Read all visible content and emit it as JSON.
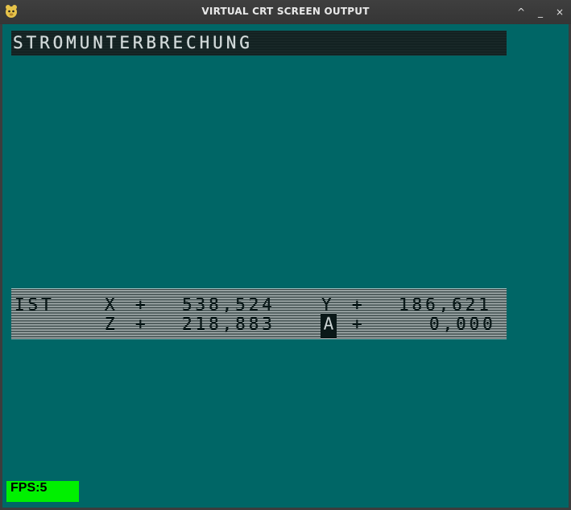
{
  "window": {
    "title": "VIRTUAL CRT SCREEN OUTPUT",
    "buttons": {
      "roll_up": "^",
      "minimize": "_",
      "close": "×"
    }
  },
  "screen": {
    "background": "#006666",
    "message": "STROMUNTERBRECHUNG",
    "position_display": {
      "label": "IST",
      "line1": {
        "axis1": "X",
        "sign1": "+",
        "value1": "538,524",
        "axis2": "Y",
        "sign2": "+",
        "value2": "186,621"
      },
      "line2": {
        "axis1": "Z",
        "sign1": "+",
        "value1": "218,883",
        "axis2": "A",
        "sign2": "+",
        "value2": "0,000"
      }
    },
    "fps": "FPS:5"
  }
}
